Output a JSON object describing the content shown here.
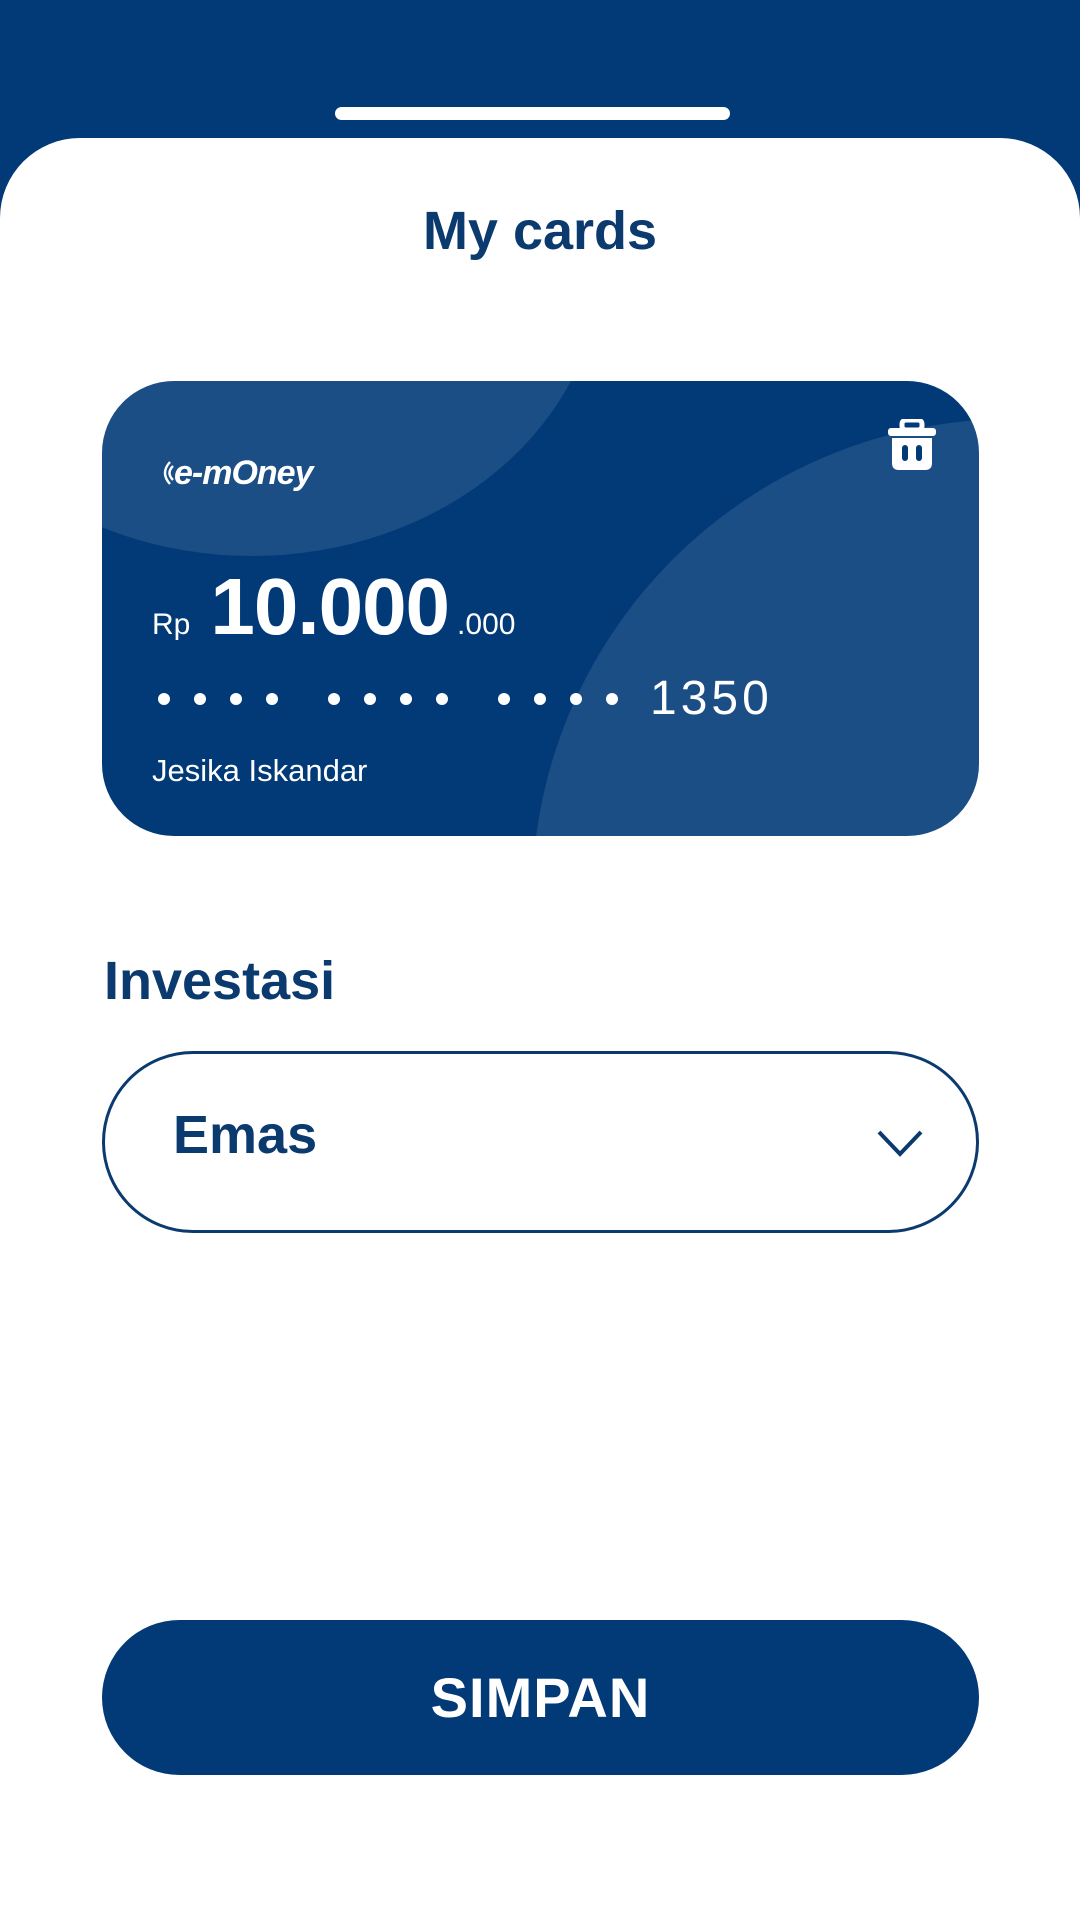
{
  "sheet": {
    "title": "My cards"
  },
  "card": {
    "brand": "e-mOney",
    "currency": "Rp",
    "amount": "10.000",
    "amount_decimal": ".000",
    "last4": "1350",
    "holder": "Jesika Iskandar",
    "delete_icon": "trash-icon"
  },
  "investment": {
    "label": "Investasi",
    "selected": "Emas",
    "dropdown_icon": "chevron-down-icon"
  },
  "actions": {
    "save_label": "SIMPAN"
  },
  "colors": {
    "primary": "#023a78",
    "text_dark": "#0b3a6e",
    "background": "#ffffff"
  }
}
